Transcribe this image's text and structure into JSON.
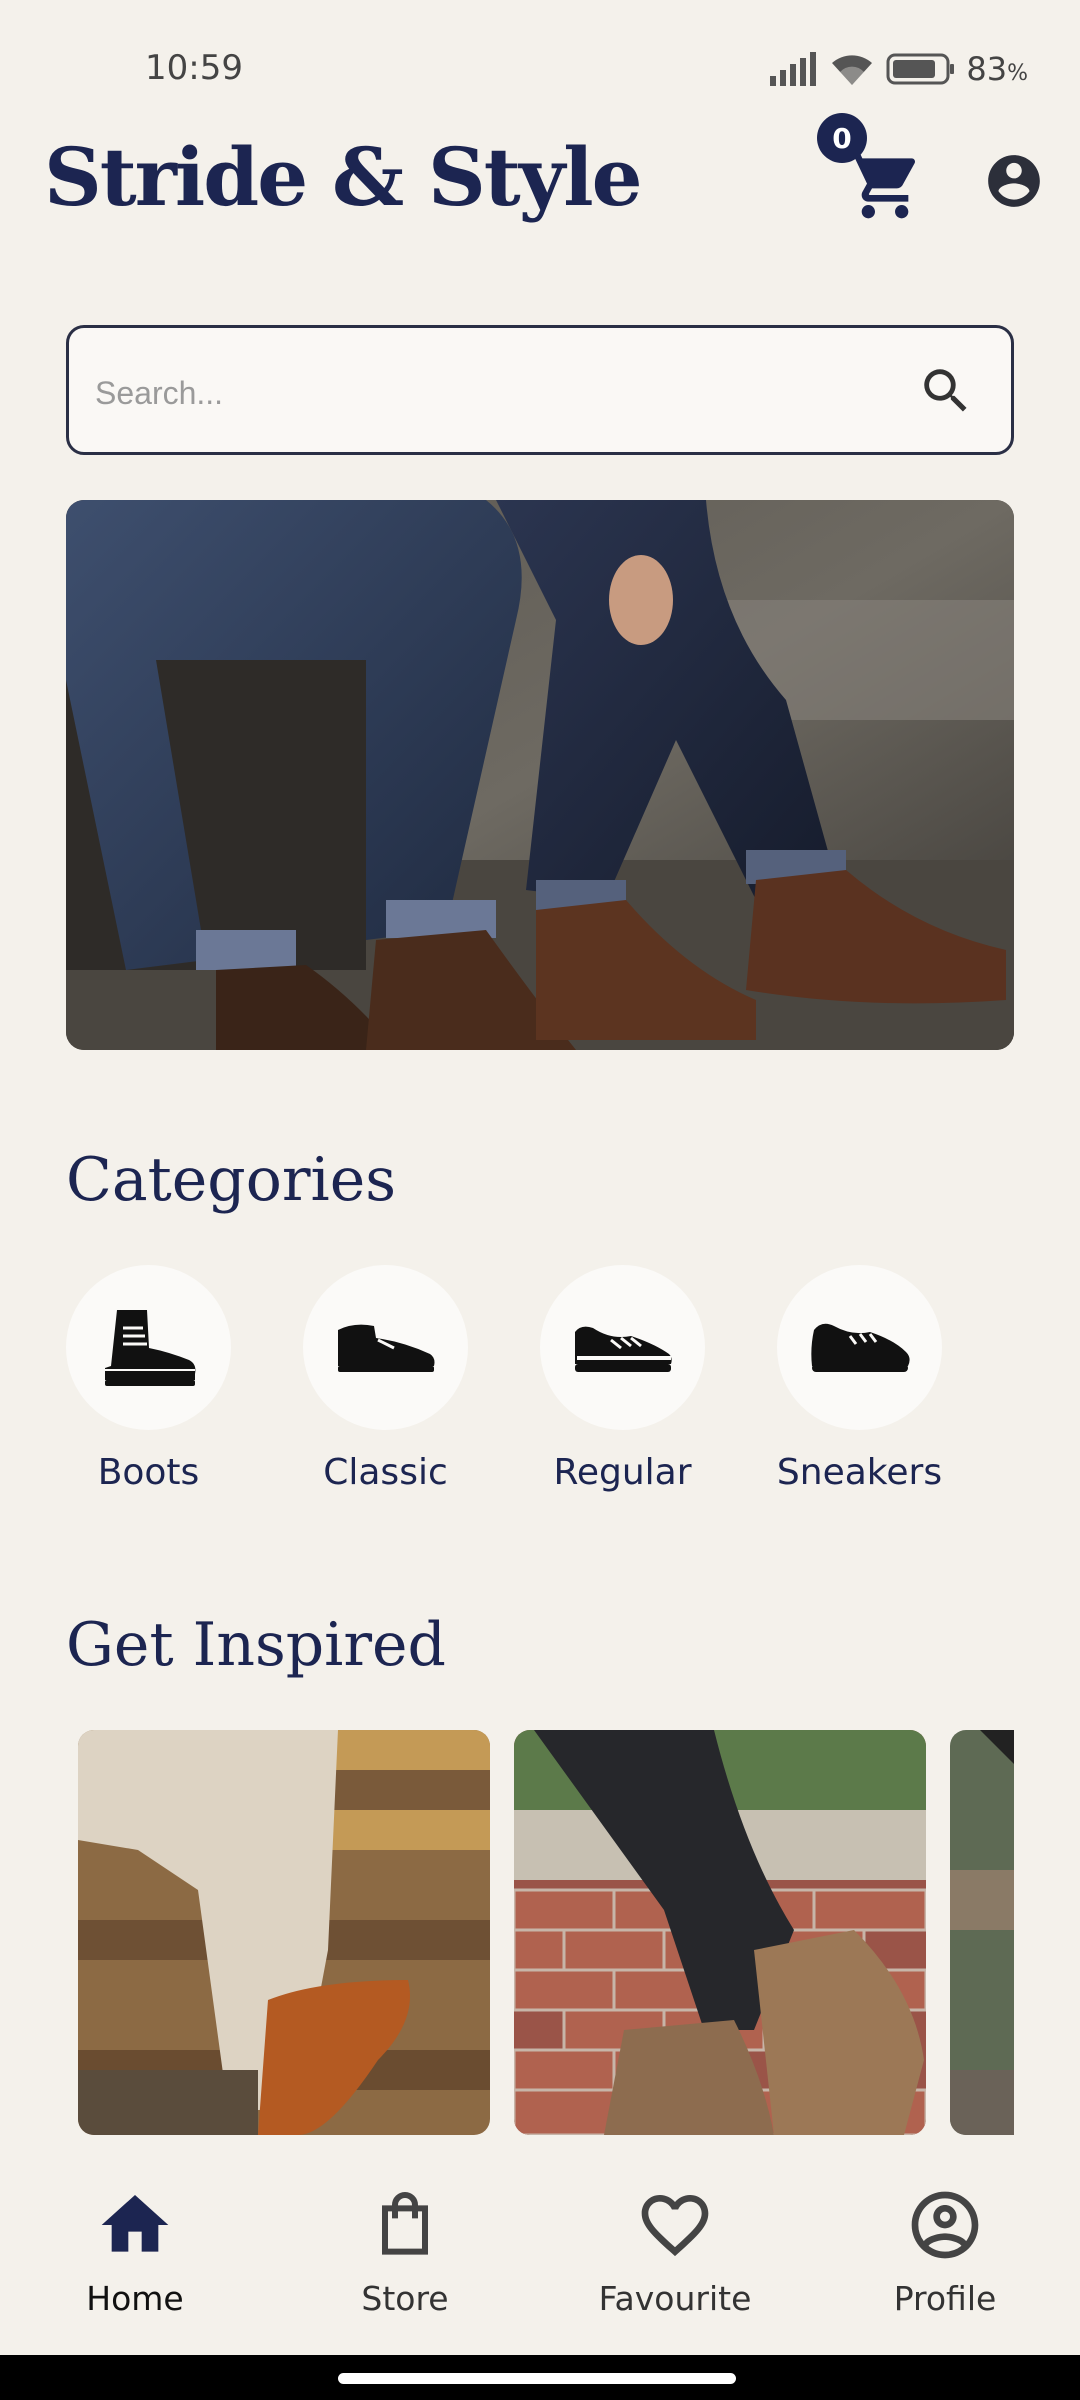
{
  "status_bar": {
    "time": "10:59",
    "battery_percent": "83",
    "battery_unit": "%"
  },
  "header": {
    "title": "Stride & Style",
    "cart_count": "0"
  },
  "search": {
    "placeholder": "Search..."
  },
  "sections": {
    "categories_title": "Categories",
    "inspired_title": "Get Inspired"
  },
  "categories": [
    {
      "label": "Boots",
      "icon": "boot-icon"
    },
    {
      "label": "Classic",
      "icon": "classic-shoe-icon"
    },
    {
      "label": "Regular",
      "icon": "regular-shoe-icon"
    },
    {
      "label": "Sneakers",
      "icon": "sneaker-icon"
    }
  ],
  "bottom_nav": [
    {
      "label": "Home",
      "icon": "home-icon",
      "active": true
    },
    {
      "label": "Store",
      "icon": "shopping-bag-icon",
      "active": false
    },
    {
      "label": "Favourite",
      "icon": "heart-icon",
      "active": false
    },
    {
      "label": "Profile",
      "icon": "account-circle-icon",
      "active": false
    }
  ],
  "colors": {
    "brand_navy": "#1c2551",
    "background": "#f4f1eb",
    "card": "#fbfaf8"
  }
}
